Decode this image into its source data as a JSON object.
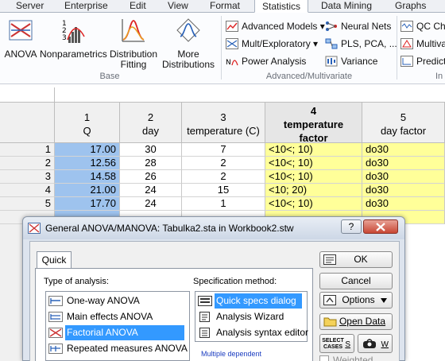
{
  "menu_tabs": [
    "Server",
    "Enterprise",
    "Edit",
    "View",
    "Format",
    "Statistics",
    "Data Mining",
    "Graphs"
  ],
  "ribbon": {
    "base": {
      "label": "Base",
      "buttons": [
        {
          "label": "ANOVA"
        },
        {
          "label": "Nonparametrics"
        },
        {
          "label": "Distribution",
          "label2": "Fitting"
        },
        {
          "label": "More",
          "label2": "Distributions"
        }
      ]
    },
    "advanced": {
      "label": "Advanced/Multivariate",
      "items": [
        {
          "label": "Advanced Models",
          "dropdown": "▾"
        },
        {
          "label": "Mult/Exploratory",
          "dropdown": "▾"
        },
        {
          "label": "Power Analysis"
        },
        {
          "label": "Neural Nets"
        },
        {
          "label": "PLS, PCA, ..."
        },
        {
          "label": "Variance"
        }
      ]
    },
    "right": {
      "items": [
        {
          "label": "QC Cha"
        },
        {
          "label": "Multiva"
        },
        {
          "label": "Predict"
        }
      ],
      "group_label": "In"
    }
  },
  "spreadsheet": {
    "columns": [
      {
        "num": "1",
        "name": "Q"
      },
      {
        "num": "2",
        "name": "day"
      },
      {
        "num": "3",
        "name": "temperature (C)"
      },
      {
        "num": "4",
        "name": "temperature",
        "name2": "factor"
      },
      {
        "num": "5",
        "name": "day factor"
      }
    ],
    "rows": [
      {
        "n": "1",
        "q": "17.00",
        "day": "30",
        "temp": "7",
        "tf": "<10<; 10)",
        "df": "do30"
      },
      {
        "n": "2",
        "q": "12.56",
        "day": "28",
        "temp": "2",
        "tf": "<10<; 10)",
        "df": "do30"
      },
      {
        "n": "3",
        "q": "14.58",
        "day": "26",
        "temp": "2",
        "tf": "<10<; 10)",
        "df": "do30"
      },
      {
        "n": "4",
        "q": "21.00",
        "day": "24",
        "temp": "15",
        "tf": "<10; 20)",
        "df": "do30"
      },
      {
        "n": "5",
        "q": "17.70",
        "day": "24",
        "temp": "1",
        "tf": "<10<; 10)",
        "df": "do30"
      }
    ]
  },
  "dialog": {
    "title": "General ANOVA/MANOVA: Tabulka2.sta in Workbook2.stw",
    "help": "?",
    "tab": "Quick",
    "type_label": "Type of analysis:",
    "analysis_types": [
      "One-way ANOVA",
      "Main effects ANOVA",
      "Factorial ANOVA",
      "Repeated measures ANOVA"
    ],
    "selected_type": "Factorial ANOVA",
    "spec_label": "Specification method:",
    "spec_methods": [
      "Quick specs dialog",
      "Analysis Wizard",
      "Analysis syntax editor"
    ],
    "selected_spec": "Quick specs dialog",
    "multiple_dependent": "Multiple dependent",
    "buttons": {
      "ok": "OK",
      "cancel": "Cancel",
      "options": "Options",
      "open_data": "Open Data",
      "select_cases": "SELECT CASES",
      "s": "S",
      "w": "W",
      "weighted": "Weighted"
    }
  }
}
